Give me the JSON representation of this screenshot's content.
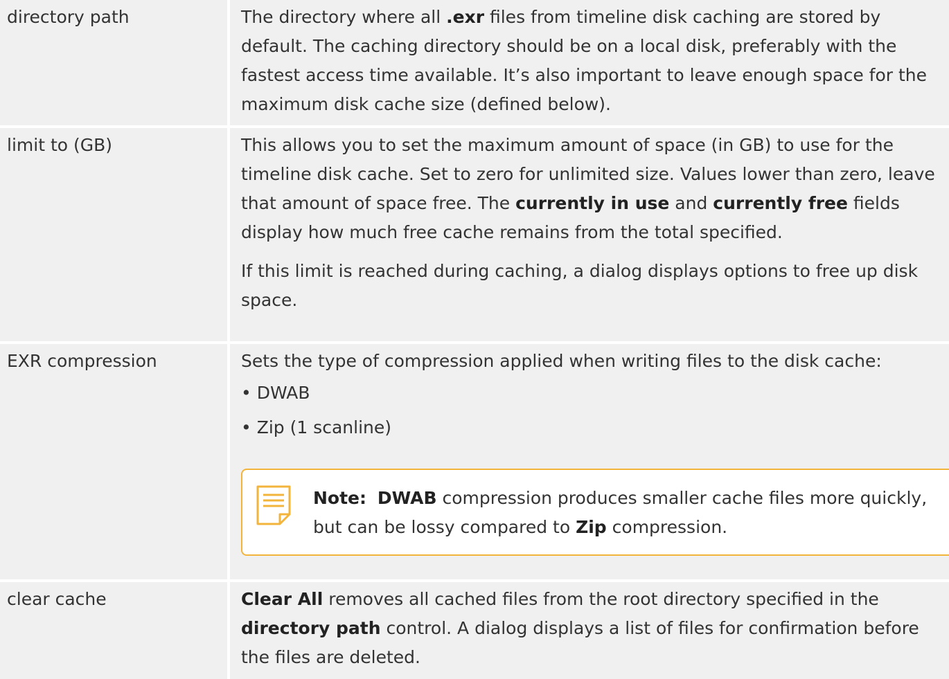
{
  "rows": [
    {
      "name": "directory path",
      "desc": {
        "p1_a": "The directory where all ",
        "p1_b": ".exr",
        "p1_c": " files from timeline disk caching are stored by default. The caching directory should be on a local disk, preferably with the fastest access time available. It’s also important to leave enough space for the maximum disk cache size (defined below)."
      }
    },
    {
      "name": "limit to (GB)",
      "desc": {
        "p1_a": "This allows you to set the maximum amount of space (in GB) to use for the timeline disk cache. Set to zero for unlimited size. Values lower than zero, leave that amount of space free. The ",
        "p1_b": "currently in use",
        "p1_c": " and ",
        "p1_d": "currently free",
        "p1_e": " fields display how much free cache remains from the total specified.",
        "p2": "If this limit is reached during caching, a dialog displays options to free up disk space."
      }
    },
    {
      "name": "EXR compression",
      "desc": {
        "p1": "Sets the type of compression applied when writing files to the disk cache:",
        "bullets": [
          "• DWAB",
          "• Zip (1 scanline)"
        ],
        "note": {
          "label": "Note:",
          "a": "DWAB",
          "b": " compression produces smaller cache files more quickly, but can be lossy compared to ",
          "c": "Zip",
          "d": " compression."
        }
      }
    },
    {
      "name": "clear cache",
      "desc": {
        "p1_a": "Clear All",
        "p1_b": " removes all cached files from the root directory specified in the ",
        "p1_c": "directory path",
        "p1_d": " control. A dialog displays a list of files for confirmation before the files are deleted."
      }
    }
  ],
  "colors": {
    "shade": "#f0f0f0",
    "note_border": "#f3b43c",
    "text": "#333333"
  },
  "icons": {
    "note": "note-icon"
  }
}
